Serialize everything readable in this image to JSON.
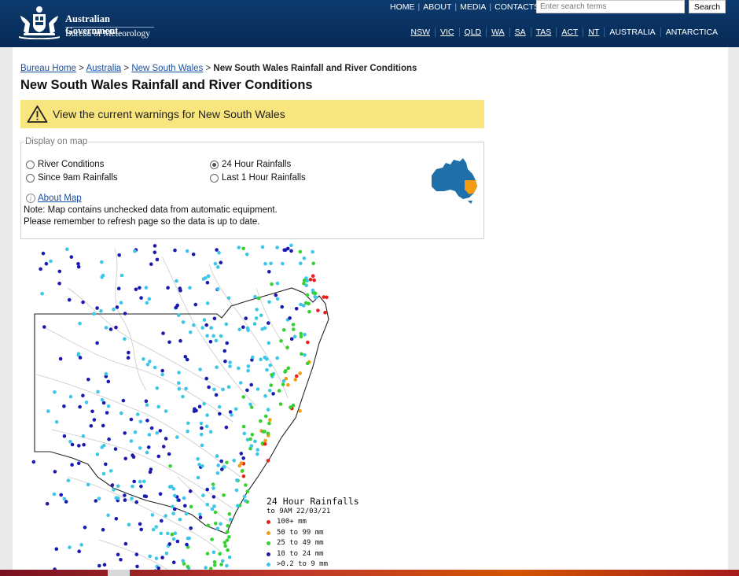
{
  "header": {
    "gov_title": "Australian Government",
    "bom_title": "Bureau of Meteorology",
    "top_nav": [
      "HOME",
      "ABOUT",
      "MEDIA",
      "CONTACTS"
    ],
    "search_placeholder": "Enter search terms",
    "search_button": "Search",
    "state_nav": [
      "NSW",
      "VIC",
      "QLD",
      "WA",
      "SA",
      "TAS",
      "ACT",
      "NT",
      "AUSTRALIA",
      "ANTARCTICA"
    ]
  },
  "breadcrumb": {
    "items": [
      "Bureau Home",
      "Australia",
      "New South Wales"
    ],
    "separator": " > ",
    "current": "New South Wales Rainfall and River Conditions"
  },
  "page_title": "New South Wales Rainfall and River Conditions",
  "warning": {
    "text": "View the current warnings for New South Wales",
    "icon": "warning-triangle-icon"
  },
  "display": {
    "legend": "Display on map",
    "options": [
      {
        "label": "River Conditions",
        "selected": false
      },
      {
        "label": "24 Hour Rainfalls",
        "selected": true
      },
      {
        "label": "Since 9am Rainfalls",
        "selected": false
      },
      {
        "label": "Last 1 Hour Rainfalls",
        "selected": false
      }
    ],
    "about_link": "About Map",
    "note1": "Note: Map contains unchecked data from automatic equipment.",
    "note2": "Please remember to refresh page so the data is up to date."
  },
  "map_legend": {
    "title": "24 Hour Rainfalls",
    "subtitle": "to 9AM 22/03/21",
    "classes": [
      {
        "label": "100+ mm",
        "color": "#e8201c"
      },
      {
        "label": "50  to 99 mm",
        "color": "#f39c12"
      },
      {
        "label": "25  to 49 mm",
        "color": "#35d12f"
      },
      {
        "label": "10  to 24 mm",
        "color": "#1a1ab0"
      },
      {
        "label": ">0.2 to 9 mm",
        "color": "#3cc6e8"
      }
    ]
  },
  "colors": {
    "header_bg": "#0d3b6e",
    "warning_bg": "#f8e57e",
    "link": "#1a4fa0",
    "australia_fill": "#1f6fa8",
    "nsw_fill": "#f39c12"
  }
}
